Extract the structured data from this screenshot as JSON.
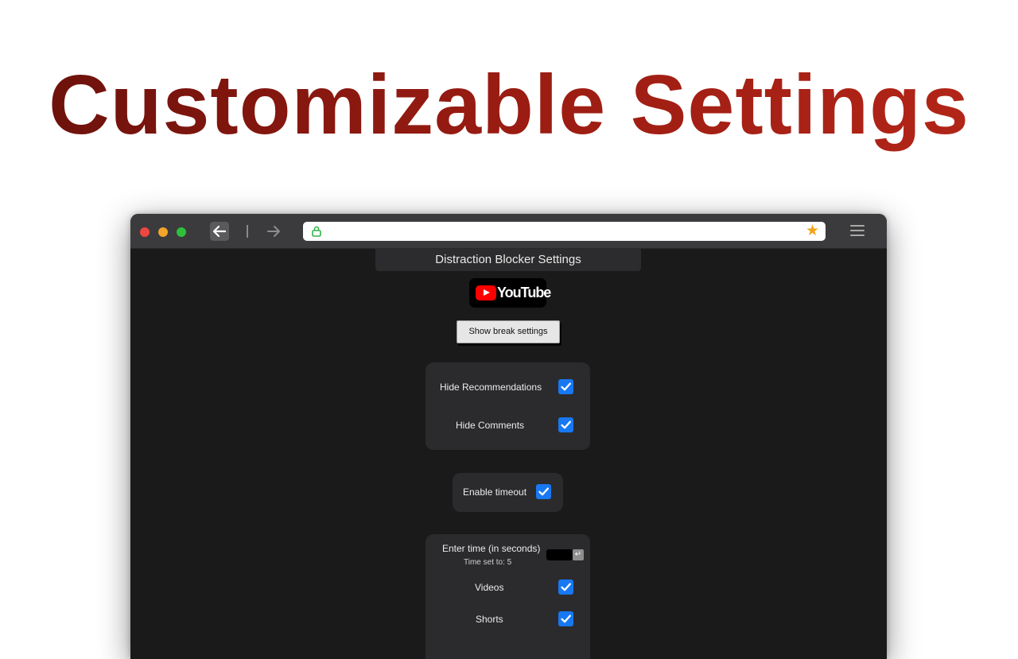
{
  "headline": "Customizable Settings",
  "browser": {
    "url": "",
    "colors": {
      "close": "#ee4640",
      "minimize": "#f3a42b",
      "maximize": "#2fbf3b",
      "bookmark_star": "#f2a51a"
    }
  },
  "extension": {
    "title": "Distraction Blocker Settings",
    "logo_text": "YouTube",
    "break_button": "Show break settings",
    "options": {
      "hide_recommendations": {
        "label": "Hide Recommendations",
        "checked": true
      },
      "hide_comments": {
        "label": "Hide Comments",
        "checked": true
      },
      "enable_timeout": {
        "label": "Enable timeout",
        "checked": true
      },
      "videos": {
        "label": "Videos",
        "checked": true
      },
      "shorts": {
        "label": "Shorts",
        "checked": true
      }
    },
    "time": {
      "label": "Enter time (in seconds)",
      "status": "Time set to: 5",
      "value": "",
      "submit_icon": "enter-key-icon"
    },
    "accent_color": "#1778f2"
  }
}
